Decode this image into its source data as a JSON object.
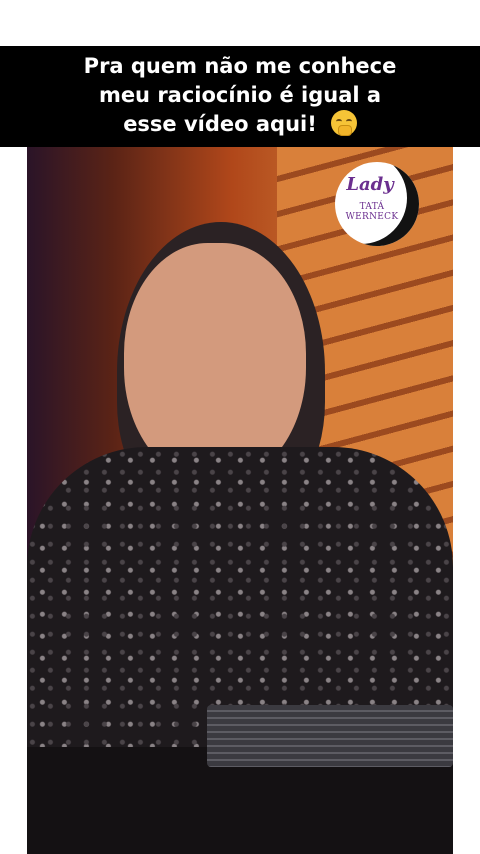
{
  "caption": {
    "lines": [
      "Pra quem não me conhece",
      "meu raciocínio é igual a",
      "esse vídeo aqui!"
    ],
    "emoji": "face-with-hand-over-mouth-icon"
  },
  "logo": {
    "script": "Lady",
    "name": "TATÁ WERNECK"
  }
}
